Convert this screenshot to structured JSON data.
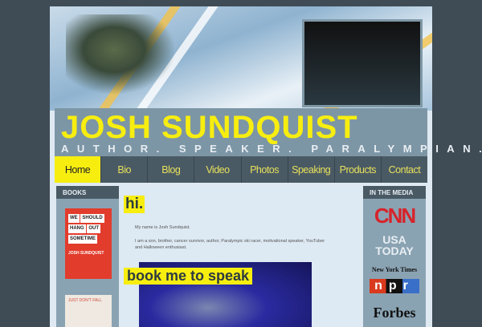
{
  "header": {
    "title": "JOSH SUNDQUIST",
    "tagline": "AUTHOR. SPEAKER. PARALYMPIAN."
  },
  "nav": [
    "Home",
    "Bio",
    "Blog",
    "Video",
    "Photos",
    "Speaking",
    "Products",
    "Contact"
  ],
  "left": {
    "heading": "BOOKS",
    "book1": {
      "words": [
        "WE",
        "HANG",
        "SHOULD",
        "OUT",
        "SOMETIME"
      ],
      "author": "JOSH SUNDQUIST"
    },
    "book2": {
      "title": "JUST DON'T FALL"
    }
  },
  "main": {
    "greeting": "hi.",
    "intro": "My name is Josh Sundquist.",
    "bio": "I am a son, brother, cancer survivor, author, Paralympic ski racer, motivational speaker, YouTuber and Halloween enthusiast.",
    "cta": "book me to speak"
  },
  "right": {
    "heading": "IN THE MEDIA",
    "logos": [
      "CNN",
      "USA TODAY",
      "New York Times",
      "npr",
      "Forbes"
    ]
  },
  "colors": {
    "accent": "#f7ee10",
    "nav": "#4a5a65",
    "band": "#7d96a6"
  }
}
